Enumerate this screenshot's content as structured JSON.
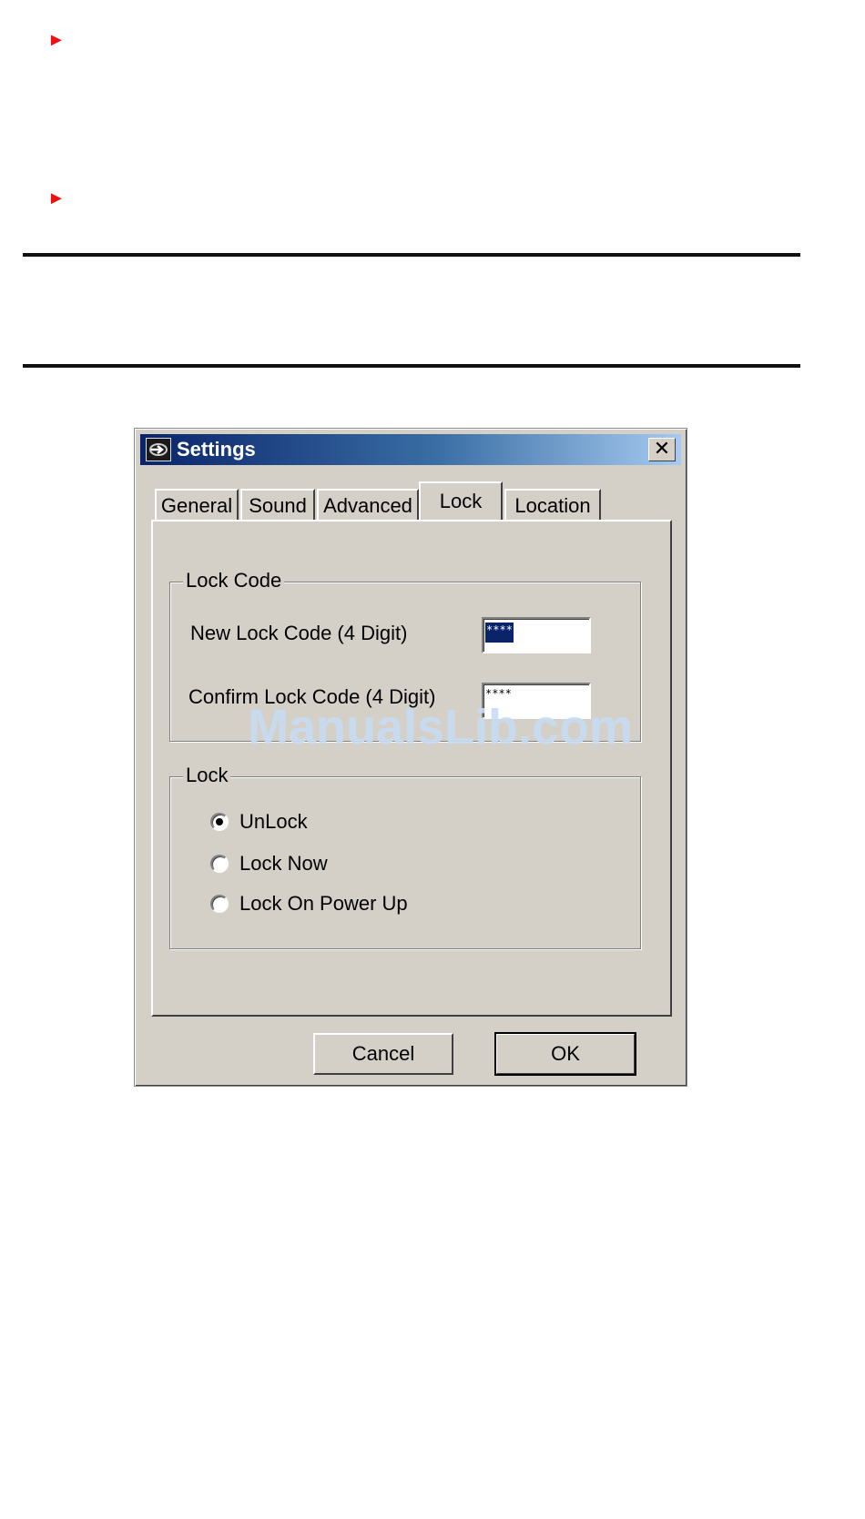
{
  "dialog": {
    "title": "Settings",
    "close_glyph": "✕",
    "icon": "app-settings-icon"
  },
  "tabs": [
    {
      "label": "General",
      "active": false
    },
    {
      "label": "Sound",
      "active": false
    },
    {
      "label": "Advanced",
      "active": false
    },
    {
      "label": "Lock",
      "active": true
    },
    {
      "label": "Location",
      "active": false
    }
  ],
  "lock_code": {
    "group_label": "Lock Code",
    "new_label": "New  Lock Code (4 Digit)",
    "new_value": "****",
    "confirm_label": "Confirm  Lock Code (4 Digit)",
    "confirm_value": "****"
  },
  "lock": {
    "group_label": "Lock",
    "options": [
      {
        "label": "UnLock",
        "selected": true
      },
      {
        "label": "Lock Now",
        "selected": false
      },
      {
        "label": "Lock On Power Up",
        "selected": false
      }
    ]
  },
  "buttons": {
    "cancel": "Cancel",
    "ok": "OK"
  },
  "page": {
    "bullet_glyph": "►",
    "watermark": "ManualsLib.com"
  },
  "colors": {
    "bullet": "#ee1111",
    "title_gradient_start": "#0a246a",
    "title_gradient_end": "#a6caf0",
    "dialog_face": "#d4d0c8"
  }
}
